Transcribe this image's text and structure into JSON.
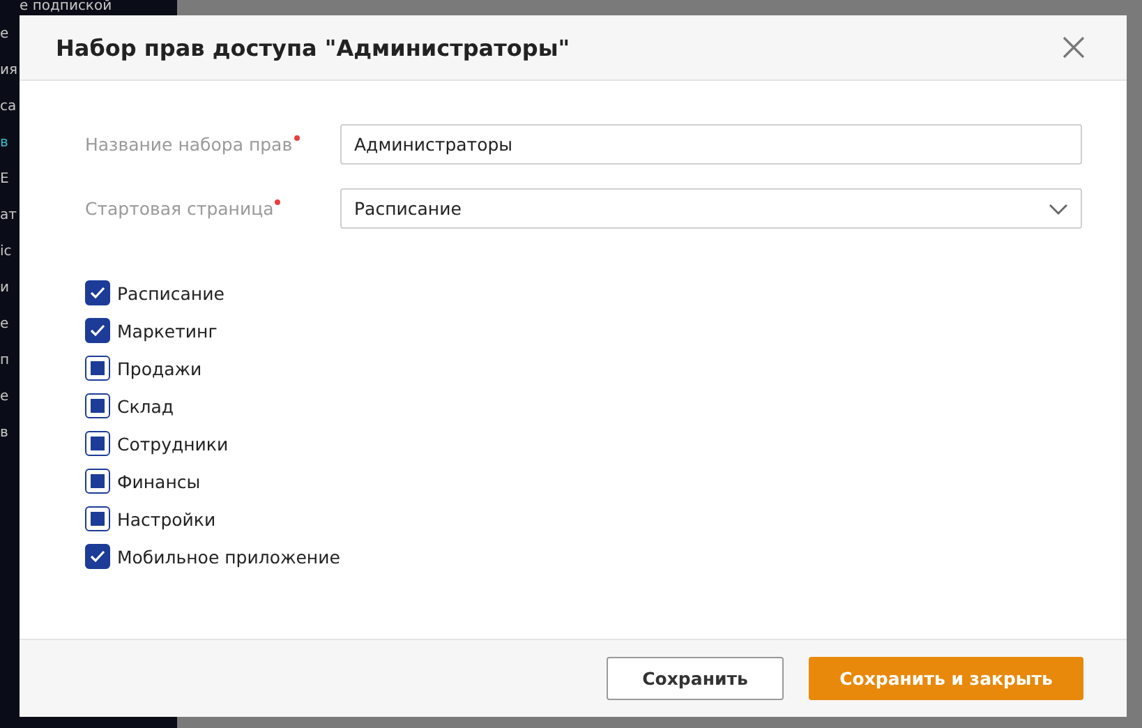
{
  "background": {
    "top_text": "е подпиской",
    "sidebar_fragments": [
      {
        "text": "е",
        "active": false
      },
      {
        "text": "ия",
        "active": false
      },
      {
        "text": "са",
        "active": false
      },
      {
        "text": "в",
        "active": true
      },
      {
        "text": "Е",
        "active": false
      },
      {
        "text": "ат",
        "active": false
      },
      {
        "text": "ic",
        "active": false
      },
      {
        "text": "и",
        "active": false
      },
      {
        "text": "е",
        "active": false
      },
      {
        "text": "п",
        "active": false
      },
      {
        "text": "е",
        "active": false
      },
      {
        "text": "в",
        "active": false
      }
    ]
  },
  "dialog": {
    "title": "Набор прав доступа \"Администраторы\"",
    "fields": [
      {
        "kind": "text",
        "label": "Название набора прав",
        "required": true,
        "value": "Администраторы"
      },
      {
        "kind": "select",
        "label": "Стартовая страница",
        "required": true,
        "value": "Расписание"
      }
    ],
    "permissions": [
      {
        "label": "Расписание",
        "checked": true,
        "partial": false
      },
      {
        "label": "Маркетинг",
        "checked": true,
        "partial": false
      },
      {
        "label": "Продажи",
        "checked": false,
        "partial": true
      },
      {
        "label": "Склад",
        "checked": false,
        "partial": true
      },
      {
        "label": "Сотрудники",
        "checked": false,
        "partial": true
      },
      {
        "label": "Финансы",
        "checked": false,
        "partial": true
      },
      {
        "label": "Настройки",
        "checked": false,
        "partial": true
      },
      {
        "label": "Мобильное приложение",
        "checked": true,
        "partial": false
      }
    ],
    "buttons": [
      {
        "kind": "secondary",
        "label": "Сохранить"
      },
      {
        "kind": "primary",
        "label": "Сохранить и закрыть"
      }
    ]
  }
}
